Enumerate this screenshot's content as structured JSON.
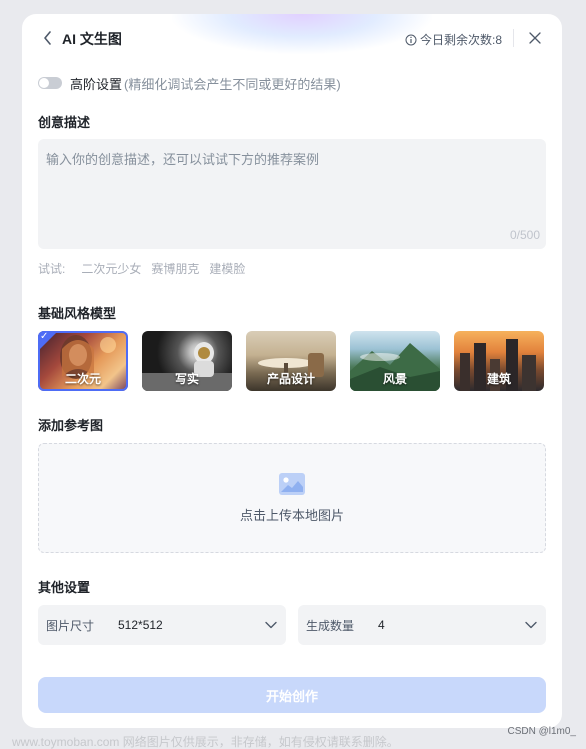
{
  "header": {
    "title": "AI 文生图",
    "quota_text": "今日剩余次数:8",
    "icons": {
      "back": "chevron-left-icon",
      "info": "info-circle-icon",
      "close": "close-icon"
    }
  },
  "advanced": {
    "label": "高阶设置",
    "note": "(精细化调试会产生不同或更好的结果)",
    "enabled": false
  },
  "prompt": {
    "section_title": "创意描述",
    "placeholder": "输入你的创意描述，还可以试试下方的推荐案例",
    "counter": "0/500"
  },
  "try": {
    "label": "试试:",
    "tags": [
      "二次元少女",
      "赛博朋克",
      "建模脸"
    ]
  },
  "styles": {
    "section_title": "基础风格模型",
    "selected_index": 0,
    "items": [
      {
        "label": "二次元"
      },
      {
        "label": "写实"
      },
      {
        "label": "产品设计"
      },
      {
        "label": "风景"
      },
      {
        "label": "建筑"
      }
    ]
  },
  "reference": {
    "section_title": "添加参考图",
    "upload_text": "点击上传本地图片",
    "icon": "image-upload-icon"
  },
  "other": {
    "section_title": "其他设置",
    "size": {
      "label": "图片尺寸",
      "value": "512*512"
    },
    "count": {
      "label": "生成数量",
      "value": "4"
    }
  },
  "start_button": "开始创作",
  "footer": {
    "watermark": "www.toymoban.com 网络图片仅供展示，非存储，如有侵权请联系删除。",
    "credit": "CSDN @l1m0_"
  },
  "colors": {
    "accent": "#4e6cf5",
    "button_disabled": "#c8d8fb",
    "input_bg": "#f2f3f5"
  }
}
